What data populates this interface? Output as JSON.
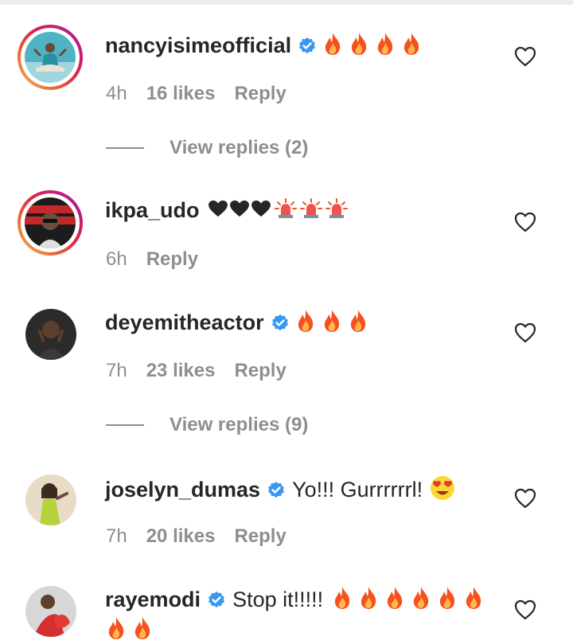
{
  "comments": [
    {
      "username": "nancyisimeofficial",
      "verified": true,
      "text": "",
      "emoji": [
        "fire",
        "fire",
        "fire",
        "fire"
      ],
      "time": "4h",
      "likes": "16 likes",
      "reply": "Reply",
      "view_replies": "View replies (2)",
      "story_ring": true
    },
    {
      "username": "ikpa_udo",
      "verified": false,
      "text": "",
      "emoji": [
        "heart",
        "heart",
        "heart",
        "siren",
        "siren",
        "siren"
      ],
      "time": "6h",
      "likes": "",
      "reply": "Reply",
      "view_replies": "",
      "story_ring": true
    },
    {
      "username": "deyemitheactor",
      "verified": true,
      "text": "",
      "emoji": [
        "fire",
        "fire",
        "fire"
      ],
      "time": "7h",
      "likes": "23 likes",
      "reply": "Reply",
      "view_replies": "View replies (9)",
      "story_ring": false
    },
    {
      "username": "joselyn_dumas",
      "verified": true,
      "text": "Yo!!! Gurrrrrrl!",
      "emoji": [
        "heart-eyes"
      ],
      "time": "7h",
      "likes": "20 likes",
      "reply": "Reply",
      "view_replies": "",
      "story_ring": false
    },
    {
      "username": "rayemodi",
      "verified": true,
      "text": "Stop it!!!!!",
      "emoji": [
        "fire",
        "fire",
        "fire",
        "fire",
        "fire",
        "fire",
        "fire",
        "fire"
      ],
      "time": "",
      "likes": "",
      "reply": "",
      "view_replies": "",
      "story_ring": false
    }
  ],
  "colors": {
    "username": "#262626",
    "meta": "#8e8e8e",
    "verified": "#3897f0"
  },
  "icons": {
    "like": "heart-outline-icon",
    "verified": "verified-badge-icon"
  }
}
